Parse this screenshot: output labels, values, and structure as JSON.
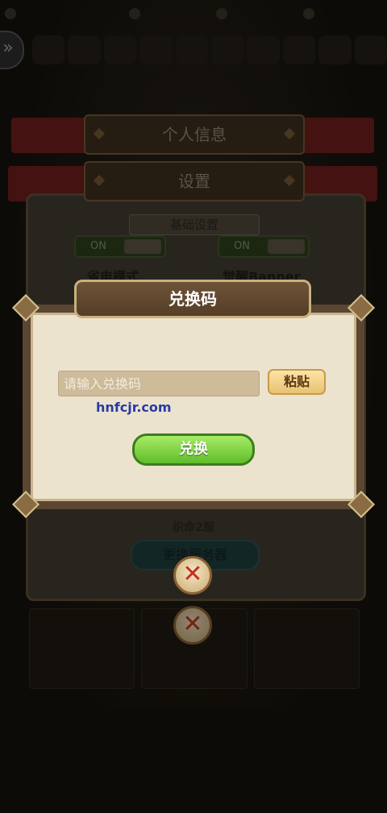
{
  "background": {
    "tabs": {
      "personal_info": "个人信息",
      "settings": "设置"
    },
    "section_header": "基础设置",
    "toggles": [
      {
        "state": "ON",
        "label": "省电模式"
      },
      {
        "state": "ON",
        "label": "觉醒Banner"
      }
    ],
    "server_name": "织命2服",
    "change_server": "更换服务器"
  },
  "dialog": {
    "title": "兑换码",
    "input_placeholder": "请输入兑换码",
    "input_value": "",
    "paste_label": "粘贴",
    "redeem_label": "兑换"
  },
  "watermark": "hnfcjr.com",
  "icons": {
    "back": "back-arrow-icon",
    "close": "close-icon"
  },
  "colors": {
    "redeem_green": "#6fcf33",
    "paste_gold": "#f0cf86",
    "close_red": "#c5301f",
    "dialog_bg": "#ece3ce"
  }
}
